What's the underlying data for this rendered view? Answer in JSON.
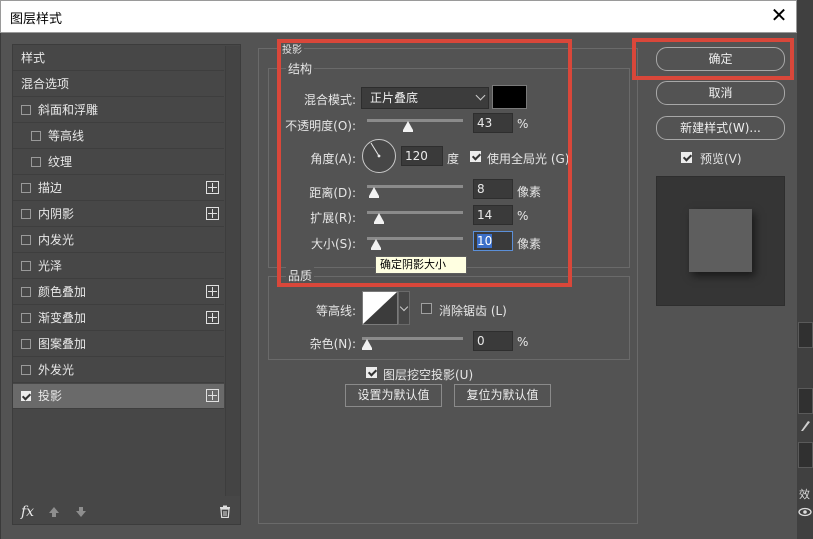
{
  "window": {
    "title": "图层样式",
    "close_glyph": "✕"
  },
  "styles_panel": {
    "header": "样式",
    "blend_options": "混合选项",
    "items": [
      {
        "label": "斜面和浮雕",
        "checked": false,
        "plus": false
      },
      {
        "label": "等高线",
        "checked": false,
        "plus": false
      },
      {
        "label": "纹理",
        "checked": false,
        "plus": false
      },
      {
        "label": "描边",
        "checked": false,
        "plus": true
      },
      {
        "label": "内阴影",
        "checked": false,
        "plus": true
      },
      {
        "label": "内发光",
        "checked": false,
        "plus": false
      },
      {
        "label": "光泽",
        "checked": false,
        "plus": false
      },
      {
        "label": "颜色叠加",
        "checked": false,
        "plus": true
      },
      {
        "label": "渐变叠加",
        "checked": false,
        "plus": true
      },
      {
        "label": "图案叠加",
        "checked": false,
        "plus": false
      },
      {
        "label": "外发光",
        "checked": false,
        "plus": false
      },
      {
        "label": "投影",
        "checked": true,
        "plus": true
      }
    ],
    "footer": {
      "fx": "fx",
      "up_icon": "arrow-up-icon",
      "down_icon": "arrow-down-icon",
      "trash_icon": "trash-icon"
    }
  },
  "drop_shadow": {
    "section_title": "投影",
    "structure_title": "结构",
    "blend_mode_label": "混合模式:",
    "blend_mode_value": "正片叠底",
    "shadow_color": "#000000",
    "opacity_label": "不透明度(O):",
    "opacity_value": "43",
    "opacity_unit": "%",
    "angle_label": "角度(A):",
    "angle_value": "120",
    "angle_unit": "度",
    "global_light_label": "使用全局光 (G)",
    "global_light_checked": true,
    "distance_label": "距离(D):",
    "distance_value": "8",
    "distance_unit": "像素",
    "spread_label": "扩展(R):",
    "spread_value": "14",
    "spread_unit": "%",
    "size_label": "大小(S):",
    "size_value": "10",
    "size_unit": "像素",
    "tooltip": "确定阴影大小",
    "quality_title": "品质",
    "contour_label": "等高线:",
    "antialias_label": "消除锯齿 (L)",
    "antialias_checked": false,
    "noise_label": "杂色(N):",
    "noise_value": "0",
    "noise_unit": "%",
    "knockout_label": "图层挖空投影(U)",
    "knockout_checked": true,
    "make_default_label": "设置为默认值",
    "reset_default_label": "复位为默认值"
  },
  "actions": {
    "ok": "确定",
    "cancel": "取消",
    "new_style": "新建样式(W)...",
    "preview_label": "预览(V)",
    "preview_checked": true
  },
  "right_strip": {
    "effects_text": "效",
    "eye_icon": "eye-icon",
    "brush_icon": "brush-icon"
  },
  "highlight_color": "#d9473a"
}
